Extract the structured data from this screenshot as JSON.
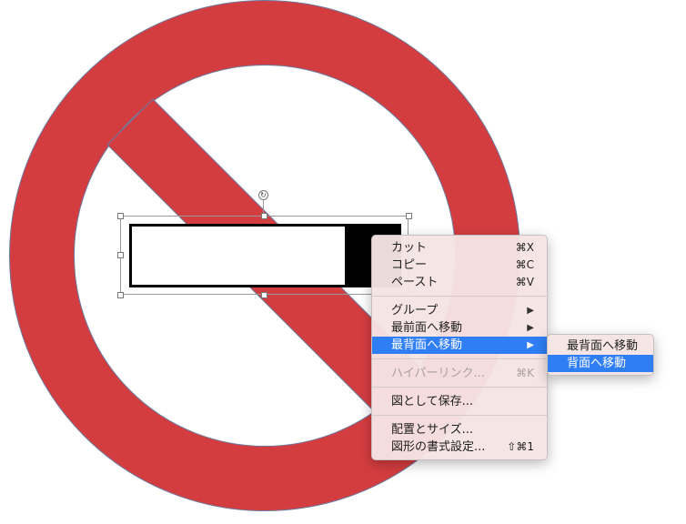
{
  "colors": {
    "ring": "#d43d40",
    "ring_stroke": "#6b7aa0",
    "rect_fill": "#ffffff",
    "rect_border": "#000000",
    "menu_highlight": "#2f7ef4"
  },
  "icons": {
    "rotate_handle": "↻",
    "submenu_arrow": "▶"
  },
  "context_menu": {
    "items": [
      {
        "label": "カット",
        "shortcut": "⌘X"
      },
      {
        "label": "コピー",
        "shortcut": "⌘C"
      },
      {
        "label": "ペースト",
        "shortcut": "⌘V"
      },
      {
        "label": "グループ"
      },
      {
        "label": "最前面へ移動"
      },
      {
        "label": "最背面へ移動"
      },
      {
        "label": "ハイパーリンク...",
        "shortcut": "⌘K"
      },
      {
        "label": "図として保存..."
      },
      {
        "label": "配置とサイズ..."
      },
      {
        "label": "図形の書式設定...",
        "shortcut": "⇧⌘1"
      }
    ]
  },
  "submenu": {
    "items": [
      {
        "label": "最背面へ移動"
      },
      {
        "label": "背面へ移動"
      }
    ]
  }
}
